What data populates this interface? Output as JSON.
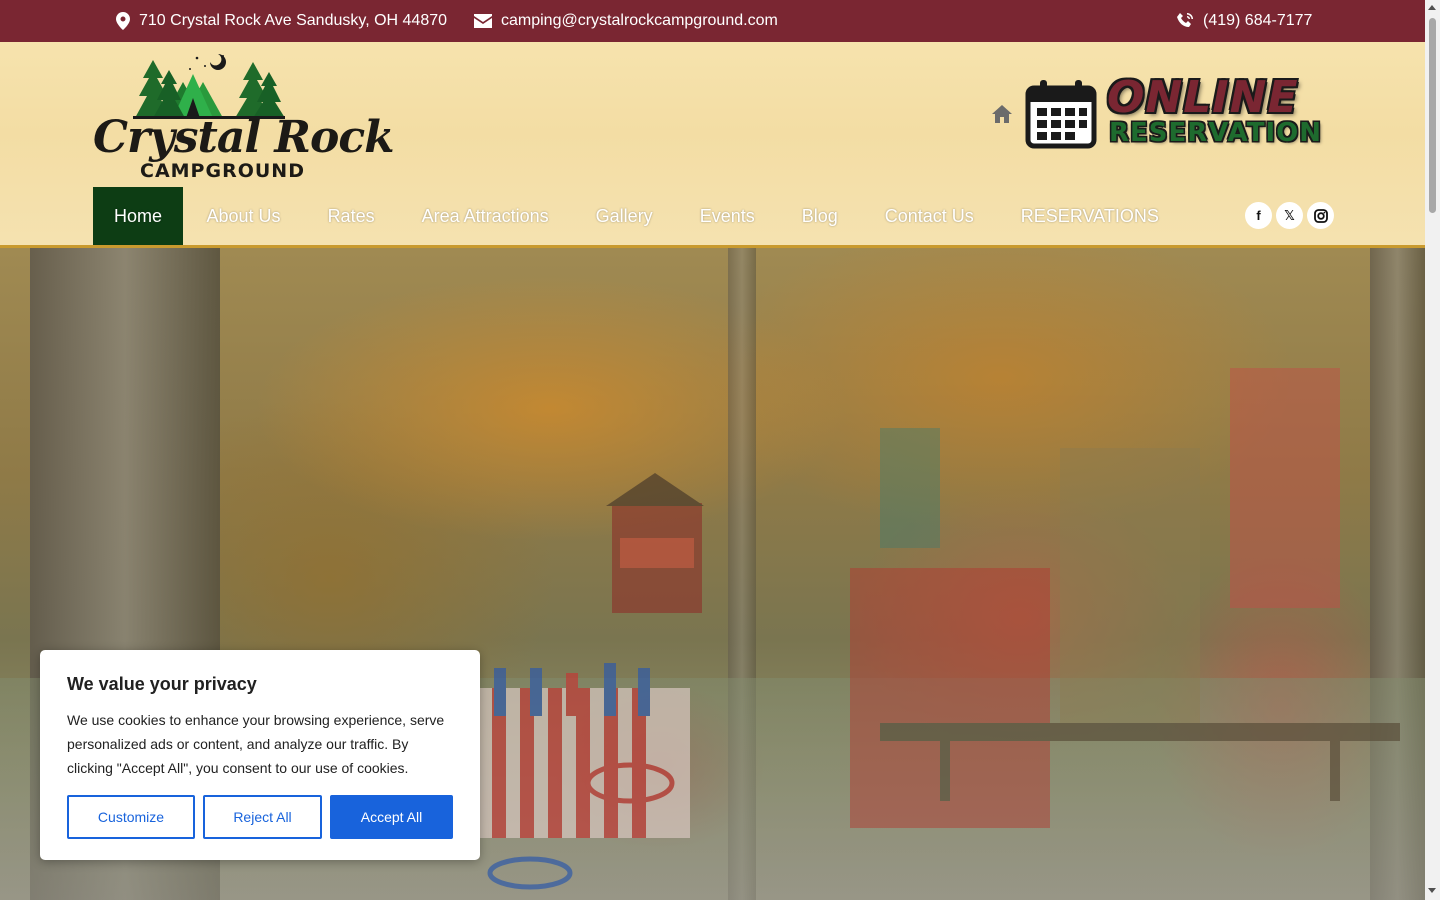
{
  "topbar": {
    "address": "710 Crystal Rock Ave Sandusky, OH 44870",
    "email": "camping@crystalrockcampground.com",
    "phone": "(419) 684-7177"
  },
  "logo": {
    "line1": "Crystal Rock",
    "line2": "CAMPGROUND"
  },
  "reservation_banner": {
    "line1": "ONLINE",
    "line2": "RESERVATION"
  },
  "nav": {
    "items": [
      "Home",
      "About Us",
      "Rates",
      "Area Attractions",
      "Gallery",
      "Events",
      "Blog",
      "Contact Us",
      "RESERVATIONS"
    ],
    "active": "Home"
  },
  "social": {
    "facebook": "f",
    "x": "𝕏"
  },
  "cookie": {
    "title": "We value your privacy",
    "body": "We use cookies to enhance your browsing experience, serve personalized ads or content, and analyze our traffic. By clicking \"Accept All\", you consent to our use of cookies.",
    "customize": "Customize",
    "reject": "Reject All",
    "accept": "Accept All"
  },
  "colors": {
    "topbar": "#7a2632",
    "nav_active": "#0d3d14",
    "accent_blue": "#1863dc"
  }
}
